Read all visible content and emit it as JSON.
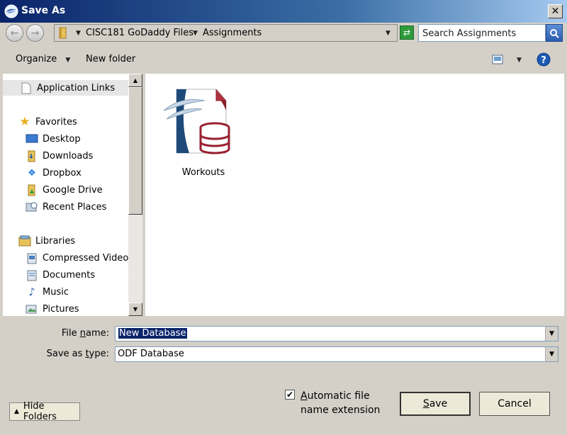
{
  "window": {
    "title": "Save As",
    "close_glyph": "✕"
  },
  "nav": {
    "back_glyph": "←",
    "forward_glyph": "→"
  },
  "breadcrumb": [
    "CISC181 GoDaddy Files",
    "Assignments"
  ],
  "search": {
    "placeholder": "Search Assignments"
  },
  "toolbar": {
    "organize": "Organize",
    "new_folder": "New folder"
  },
  "navpane": {
    "application_links": "Application Links",
    "favorites_header": "Favorites",
    "favorites": [
      "Desktop",
      "Downloads",
      "Dropbox",
      "Google Drive",
      "Recent Places"
    ],
    "libraries_header": "Libraries",
    "libraries": [
      "Compressed Video",
      "Documents",
      "Music",
      "Pictures"
    ]
  },
  "files": [
    {
      "name": "Workouts",
      "icon": "odf-database-icon"
    }
  ],
  "form": {
    "file_name_label_pre": "File ",
    "file_name_label_key": "n",
    "file_name_label_post": "ame:",
    "file_name_value": "New Database",
    "save_type_label_pre": "Save as ",
    "save_type_label_key": "t",
    "save_type_label_post": "ype:",
    "save_type_value": "ODF Database"
  },
  "options": {
    "auto_ext_key": "A",
    "auto_ext_line1_rest": "utomatic file",
    "auto_ext_line2": "name extension",
    "auto_ext_checked": true
  },
  "buttons": {
    "save_key": "S",
    "save_rest": "ave",
    "cancel": "Cancel",
    "hide_folders": "Hide Folders"
  },
  "colors": {
    "title_start": "#0a246a",
    "title_end": "#a6caf0",
    "selection": "#0a246a",
    "help": "#1c5ab4"
  }
}
